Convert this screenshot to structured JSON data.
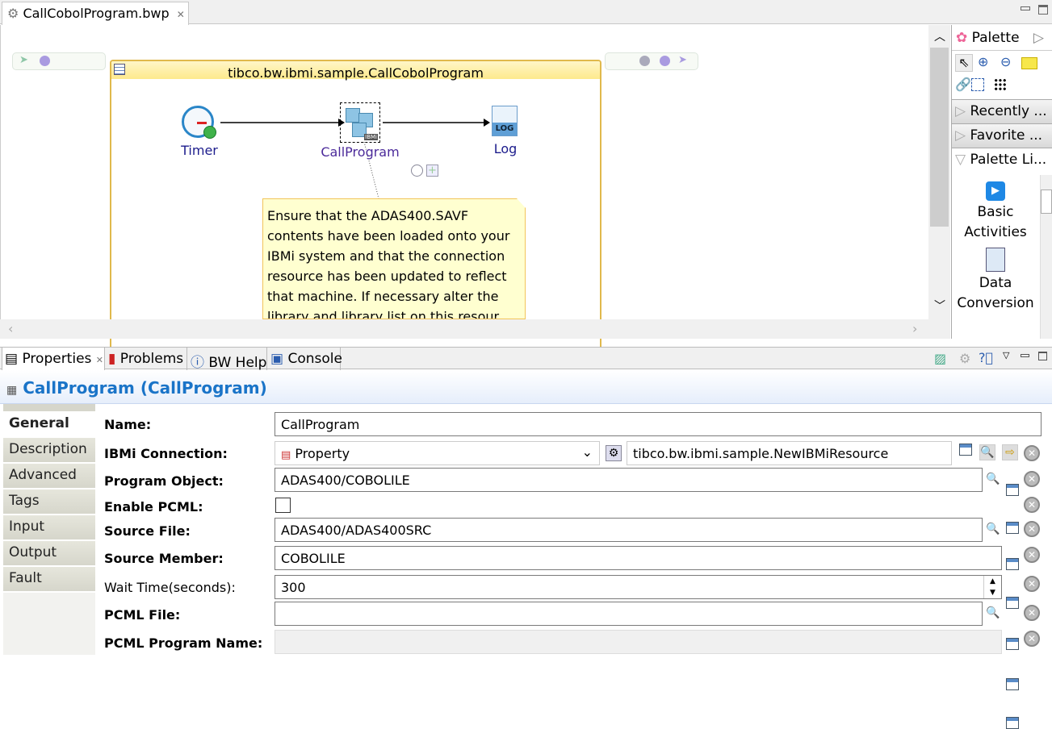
{
  "editor": {
    "tab_label": "CallCobolProgram.bwp",
    "process_name": "tibco.bw.ibmi.sample.CallCobolProgram",
    "activities": [
      {
        "label": "Timer"
      },
      {
        "label": "CallProgram"
      },
      {
        "label": "Log",
        "icon_text": "LOG"
      }
    ],
    "note": "Ensure that the ADAS400.SAVF contents have been loaded onto your IBMi system and that the connection resource has been updated to reflect that machine.  If necessary alter the library and library list on this resour"
  },
  "palette": {
    "title": "Palette",
    "drawers": [
      "Recently ...",
      "Favorite ...",
      "Palette Li..."
    ],
    "items": [
      "Basic Activities",
      "Data Conversion"
    ]
  },
  "bottom": {
    "tabs": [
      "Properties",
      "Problems",
      "BW Help",
      "Console"
    ],
    "title": "CallProgram (CallProgram)",
    "side_tabs": [
      "General",
      "Description",
      "Advanced",
      "Tags",
      "Input",
      "Output",
      "Fault"
    ],
    "fields": {
      "name": {
        "label": "Name:",
        "value": "CallProgram"
      },
      "connection": {
        "label": "IBMi Connection:",
        "select": "Property",
        "value": "tibco.bw.ibmi.sample.NewIBMiResource"
      },
      "program_object": {
        "label": "Program Object:",
        "value": "ADAS400/COBOLILE"
      },
      "enable_pcml": {
        "label": "Enable PCML:",
        "checked": false
      },
      "source_file": {
        "label": "Source File:",
        "value": "ADAS400/ADAS400SRC"
      },
      "source_member": {
        "label": "Source Member:",
        "value": "COBOLILE"
      },
      "wait_time": {
        "label": "Wait Time(seconds):",
        "value": "300"
      },
      "pcml_file": {
        "label": "PCML File:",
        "value": ""
      },
      "pcml_program_name": {
        "label": "PCML Program Name:",
        "value": ""
      }
    }
  }
}
